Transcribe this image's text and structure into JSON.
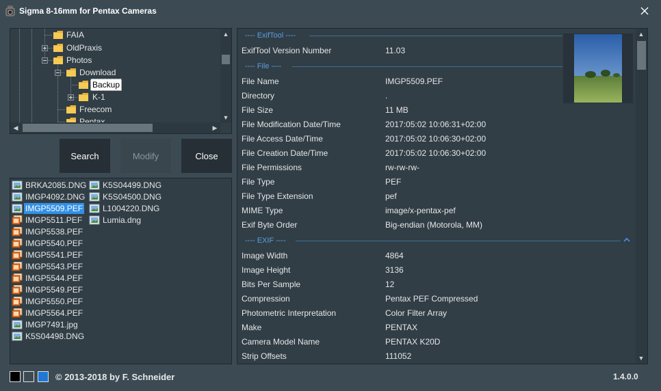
{
  "window": {
    "title": "Sigma 8-16mm for Pentax Cameras"
  },
  "tree": {
    "items": [
      {
        "label": "FAIA"
      },
      {
        "label": "OldPraxis"
      },
      {
        "label": "Photos"
      },
      {
        "label": "Download"
      },
      {
        "label": "Backup"
      },
      {
        "label": "K-1"
      },
      {
        "label": "Freecom"
      },
      {
        "label": "Pentax"
      }
    ]
  },
  "buttons": {
    "search": "Search",
    "modify": "Modify",
    "close": "Close"
  },
  "files": {
    "col1": [
      "BRKA2085.DNG",
      "IMGP4092.DNG",
      "IMGP5509.PEF",
      "IMGP5511.PEF",
      "IMGP5538.PEF",
      "IMGP5540.PEF",
      "IMGP5541.PEF",
      "IMGP5543.PEF",
      "IMGP5544.PEF",
      "IMGP5549.PEF",
      "IMGP5550.PEF",
      "IMGP5564.PEF",
      "IMGP7491.jpg",
      "K5S04498.DNG"
    ],
    "col2": [
      "K5S04499.DNG",
      "K5S04500.DNG",
      "L1004220.DNG",
      "Lumia.dng"
    ],
    "selected": "IMGP5509.PEF"
  },
  "exif": {
    "groups": {
      "exiftool": "---- ExifTool ----",
      "file": "---- File ----",
      "exif": "---- EXIF ----"
    },
    "exiftool_rows": [
      {
        "label": "ExifTool Version Number",
        "value": "11.03"
      }
    ],
    "file_rows": [
      {
        "label": "File Name",
        "value": "IMGP5509.PEF"
      },
      {
        "label": "Directory",
        "value": "."
      },
      {
        "label": "File Size",
        "value": "11 MB"
      },
      {
        "label": "File Modification Date/Time",
        "value": "2017:05:02 10:06:31+02:00"
      },
      {
        "label": "File Access Date/Time",
        "value": "2017:05:02 10:06:30+02:00"
      },
      {
        "label": "File Creation Date/Time",
        "value": "2017:05:02 10:06:30+02:00"
      },
      {
        "label": "File Permissions",
        "value": "rw-rw-rw-"
      },
      {
        "label": "File Type",
        "value": "PEF"
      },
      {
        "label": "File Type Extension",
        "value": "pef"
      },
      {
        "label": "MIME Type",
        "value": "image/x-pentax-pef"
      },
      {
        "label": "Exif Byte Order",
        "value": "Big-endian (Motorola, MM)"
      }
    ],
    "exif_rows": [
      {
        "label": "Image Width",
        "value": "4864"
      },
      {
        "label": "Image Height",
        "value": "3136"
      },
      {
        "label": "Bits Per Sample",
        "value": "12"
      },
      {
        "label": "Compression",
        "value": "Pentax PEF Compressed"
      },
      {
        "label": "Photometric Interpretation",
        "value": "Color Filter Array"
      },
      {
        "label": "Make",
        "value": "PENTAX"
      },
      {
        "label": "Camera Model Name",
        "value": "PENTAX K20D"
      },
      {
        "label": "Strip Offsets",
        "value": "111052"
      }
    ]
  },
  "footer": {
    "copyright": "© 2013-2018 by F. Schneider",
    "version": "1.4.0.0",
    "swatches": [
      "#000000",
      "#3c4a53",
      "#1e78d4"
    ]
  },
  "colors": {
    "background": "#3c4a53",
    "panel": "#313e46",
    "accent": "#3390e6",
    "group_text": "#5a9fe0"
  },
  "icons": {
    "close": "close-icon",
    "folder": "folder-icon",
    "image_file": "image-file-icon",
    "raw_file": "raw-file-icon"
  }
}
